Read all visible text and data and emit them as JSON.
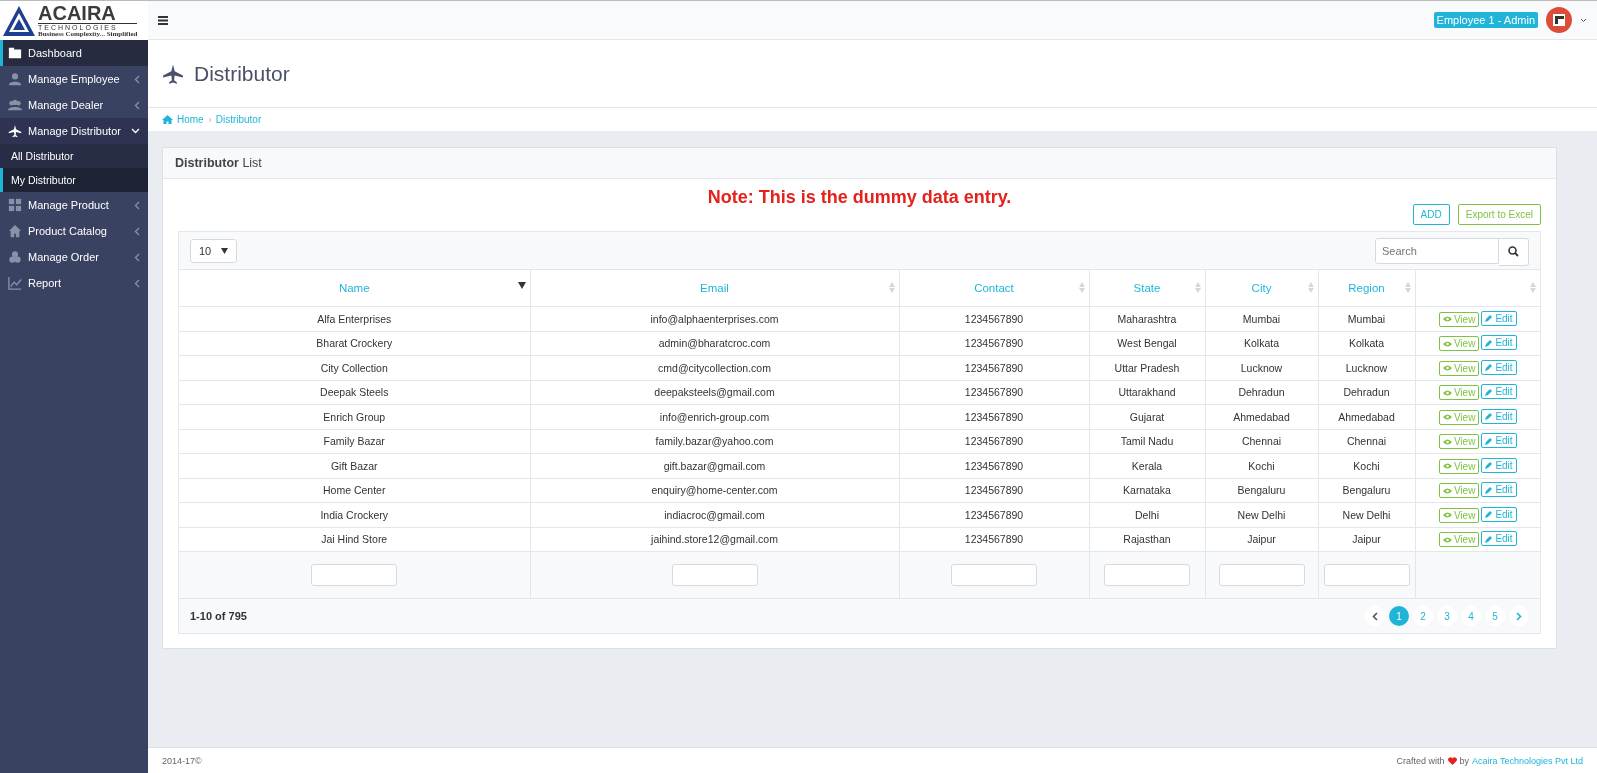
{
  "logo": {
    "name": "ACAIRA",
    "subtitle": "TECHNOLOGIES",
    "tagline": "Business Complexity... Simplified"
  },
  "header": {
    "user_badge": "Employee 1 - Admin"
  },
  "sidebar": {
    "items": [
      {
        "label": "Dashboard",
        "selected": true,
        "expanded": false,
        "has_arrow": false
      },
      {
        "label": "Manage Employee",
        "selected": false,
        "expanded": false,
        "has_arrow": true
      },
      {
        "label": "Manage Dealer",
        "selected": false,
        "expanded": false,
        "has_arrow": true
      },
      {
        "label": "Manage Distributor",
        "selected": false,
        "expanded": true,
        "has_arrow": true,
        "children": [
          {
            "label": "All Distributor",
            "selected": false
          },
          {
            "label": "My Distributor",
            "selected": true
          }
        ]
      },
      {
        "label": "Manage Product",
        "selected": false,
        "expanded": false,
        "has_arrow": true
      },
      {
        "label": "Product Catalog",
        "selected": false,
        "expanded": false,
        "has_arrow": true
      },
      {
        "label": "Manage Order",
        "selected": false,
        "expanded": false,
        "has_arrow": true
      },
      {
        "label": "Report",
        "selected": false,
        "expanded": false,
        "has_arrow": true
      }
    ]
  },
  "page": {
    "title": "Distributor",
    "breadcrumb": [
      "Home",
      "Distributor"
    ]
  },
  "panel": {
    "title_bold": "Distributor",
    "title_rest": "List",
    "note": "Note: This is the dummy data entry.",
    "buttons": [
      {
        "label": "ADD",
        "kind": "primary"
      },
      {
        "label": "Export to Excel",
        "kind": "success"
      }
    ]
  },
  "table": {
    "page_size": "10",
    "search": {
      "placeholder": "Search"
    },
    "columns": [
      {
        "label": "Name",
        "sorted": true
      },
      {
        "label": "Email",
        "sorted": false
      },
      {
        "label": "Contact",
        "sorted": false
      },
      {
        "label": "State",
        "sorted": false
      },
      {
        "label": "City",
        "sorted": false
      },
      {
        "label": "Region",
        "sorted": false
      },
      {
        "sorted": false
      }
    ],
    "rows": [
      {
        "name": "Alfa Enterprises",
        "email": "info@alphaenterprises.com",
        "contact": "1234567890",
        "state": "Maharashtra",
        "city": "Mumbai",
        "region": "Mumbai",
        "actions": [
          "View",
          "Edit"
        ]
      },
      {
        "name": "Bharat Crockery",
        "email": "admin@bharatcroc.com",
        "contact": "1234567890",
        "state": "West Bengal",
        "city": "Kolkata",
        "region": "Kolkata",
        "actions": [
          "View",
          "Edit"
        ]
      },
      {
        "name": "City Collection",
        "email": "cmd@citycollection.com",
        "contact": "1234567890",
        "state": "Uttar Pradesh",
        "city": "Lucknow",
        "region": "Lucknow",
        "actions": [
          "View",
          "Edit"
        ]
      },
      {
        "name": "Deepak Steels",
        "email": "deepaksteels@gmail.com",
        "contact": "1234567890",
        "state": "Uttarakhand",
        "city": "Dehradun",
        "region": "Dehradun",
        "actions": [
          "View",
          "Edit"
        ]
      },
      {
        "name": "Enrich Group",
        "email": "info@enrich-group.com",
        "contact": "1234567890",
        "state": "Gujarat",
        "city": "Ahmedabad",
        "region": "Ahmedabad",
        "actions": [
          "View",
          "Edit"
        ]
      },
      {
        "name": "Family Bazar",
        "email": "family.bazar@yahoo.com",
        "contact": "1234567890",
        "state": "Tamil Nadu",
        "city": "Chennai",
        "region": "Chennai",
        "actions": [
          "View",
          "Edit"
        ]
      },
      {
        "name": "Gift Bazar",
        "email": "gift.bazar@gmail.com",
        "contact": "1234567890",
        "state": "Kerala",
        "city": "Kochi",
        "region": "Kochi",
        "actions": [
          "View",
          "Edit"
        ]
      },
      {
        "name": "Home Center",
        "email": "enquiry@home-center.com",
        "contact": "1234567890",
        "state": "Karnataka",
        "city": "Bengaluru",
        "region": "Bengaluru",
        "actions": [
          "View",
          "Edit"
        ]
      },
      {
        "name": "India Crockery",
        "email": "indiacroc@gmail.com",
        "contact": "1234567890",
        "state": "Delhi",
        "city": "New Delhi",
        "region": "New Delhi",
        "actions": [
          "View",
          "Edit"
        ]
      },
      {
        "name": "Jai Hind Store",
        "email": "jaihind.store12@gmail.com",
        "contact": "1234567890",
        "state": "Rajasthan",
        "city": "Jaipur",
        "region": "Jaipur",
        "actions": [
          "View",
          "Edit"
        ]
      }
    ],
    "range": "1-10 of 795",
    "pages": [
      {
        "label": "1",
        "selected": true
      },
      {
        "label": "2",
        "selected": false
      },
      {
        "label": "3",
        "selected": false
      },
      {
        "label": "4",
        "selected": false
      },
      {
        "label": "5",
        "selected": false
      }
    ]
  },
  "footer": {
    "copyright": "2014-17©",
    "crafted_with": "Crafted with",
    "by": "by",
    "company": "Acaira Technologies Pvt Ltd"
  }
}
